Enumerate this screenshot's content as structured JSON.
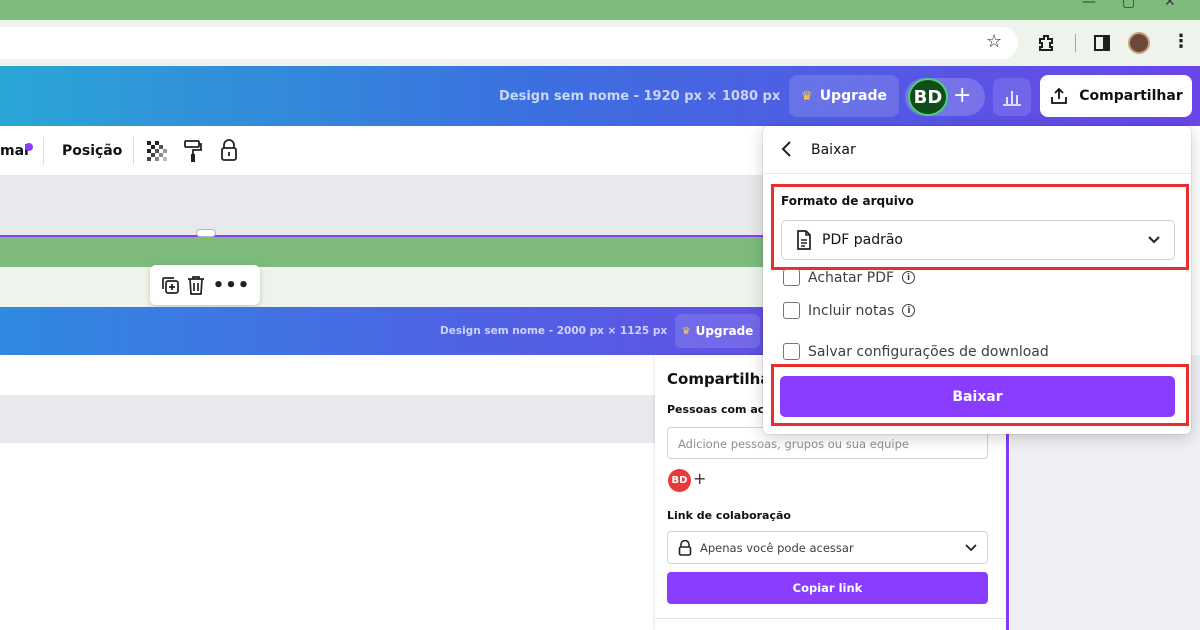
{
  "header": {
    "design_name": "Design sem nome - 1920 px × 1080 px",
    "upgrade_label": "Upgrade",
    "avatar_initials": "BD",
    "share_label": "Compartilhar"
  },
  "toolbar": {
    "effect_partial": "mai",
    "position_label": "Posição"
  },
  "inner": {
    "design_name": "Design sem nome - 2000 px × 1125 px",
    "upgrade_label": "Upgrade"
  },
  "share_panel": {
    "title": "Compartilhar",
    "people_label": "Pessoas com ace",
    "add_placeholder": "Adicione pessoas, grupos ou sua equipe",
    "avatar_initials": "BD",
    "link_label": "Link de colaboração",
    "access_value": "Apenas você pode acessar",
    "copy_label": "Copiar link"
  },
  "download": {
    "title": "Baixar",
    "format_label": "Formato de arquivo",
    "format_value": "PDF padrão",
    "flatten_label": "Achatar PDF",
    "notes_label": "Incluir notas",
    "save_settings_label": "Salvar configurações de download",
    "download_button": "Baixar"
  },
  "colors": {
    "brand_purple": "#8b3dff",
    "highlight_red": "#ea2d2d",
    "chrome_green": "#7dbb7c"
  }
}
